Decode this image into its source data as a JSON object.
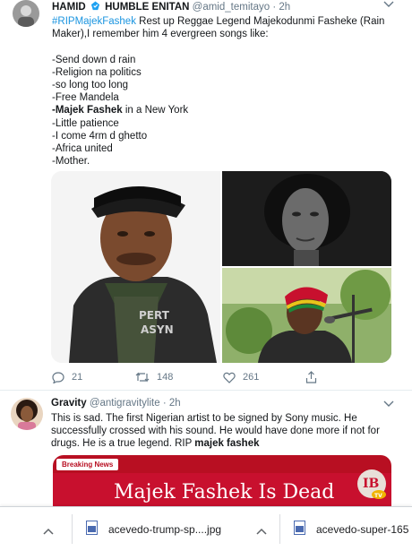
{
  "tweet1": {
    "display_name": "HAMID",
    "display_name_2": "HUMBLE ENITAN",
    "handle": "@amid_temitayo",
    "time": "2h",
    "hashtag": "#RIPMajekFashek",
    "text_line1_rest": " Rest up Reggae Legend Majekodunmi Fasheke (Rain",
    "text_line2": "Maker),I remember him 4 evergreen songs like:",
    "songs": [
      "-Send down d rain",
      "-Religion na politics",
      "-so long too long",
      "-Free Mandela"
    ],
    "song_bold_prefix": "-",
    "song_bold": "Majek Fashek",
    "song_bold_rest": " in a New York",
    "songs_after": [
      "-Little patience",
      "-I come 4rm d ghetto",
      "-Africa united",
      "-Mother."
    ],
    "reply_count": "21",
    "retweet_count": "148",
    "like_count": "261"
  },
  "tweet2": {
    "display_name": "Gravity",
    "handle": "@antigravitylite",
    "time": "2h",
    "text_lines": [
      "This is sad. The first Nigerian artist to be signed by Sony music. He",
      "successfully crossed with his sound. He would have done more if not for"
    ],
    "text_line3_plain": "drugs. He is a true legend. RIP ",
    "text_line3_bold": "majek fashek",
    "image_tag": "Breaking News",
    "image_headline": "Majek Fashek Is Dead"
  },
  "downloads": {
    "item1": "acevedo-trump-sp....jpg",
    "item2": "acevedo-super-165"
  },
  "colors": {
    "link": "#1b95e0",
    "meta": "#657786",
    "verified": "#1da1f2",
    "breaking_red": "#c8102e"
  }
}
